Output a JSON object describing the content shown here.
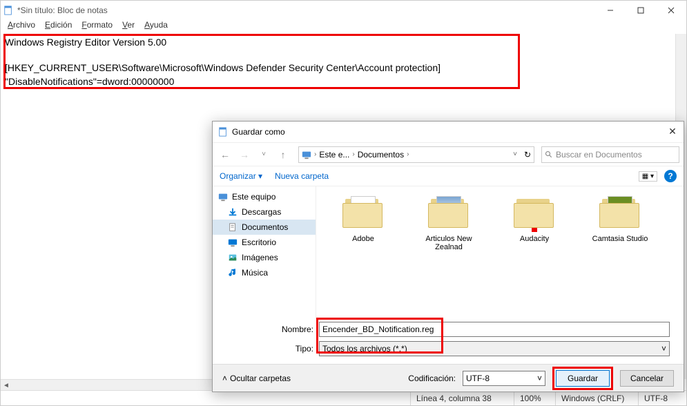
{
  "notepad": {
    "title": "*Sin título: Bloc de notas",
    "menu": [
      "Archivo",
      "Edición",
      "Formato",
      "Ver",
      "Ayuda"
    ],
    "line1": "Windows Registry Editor Version 5.00",
    "line2": "[HKEY_CURRENT_USER\\Software\\Microsoft\\Windows Defender Security Center\\Account protection]",
    "line3": "\"DisableNotifications\"=dword:00000000",
    "status": {
      "pos": "Línea 4, columna 38",
      "zoom": "100%",
      "eol": "Windows (CRLF)",
      "enc": "UTF-8"
    }
  },
  "dialog": {
    "title": "Guardar como",
    "breadcrumb": {
      "a": "Este e...",
      "b": "Documentos"
    },
    "search_ph": "Buscar en Documentos",
    "toolbar": {
      "organize": "Organizar",
      "newfolder": "Nueva carpeta"
    },
    "tree": {
      "pc": "Este equipo",
      "downloads": "Descargas",
      "docs": "Documentos",
      "desktop": "Escritorio",
      "images": "Imágenes",
      "music": "Música"
    },
    "files": [
      "Adobe",
      "Articulos New Zealnad",
      "Audacity",
      "Camtasia Studio"
    ],
    "fields": {
      "name_lbl": "Nombre:",
      "name_val": "Encender_BD_Notification.reg",
      "type_lbl": "Tipo:",
      "type_val": "Todos los archivos  (*.*)"
    },
    "footer": {
      "hide": "Ocultar carpetas",
      "enc_lbl": "Codificación:",
      "enc_val": "UTF-8",
      "save": "Guardar",
      "cancel": "Cancelar"
    }
  }
}
